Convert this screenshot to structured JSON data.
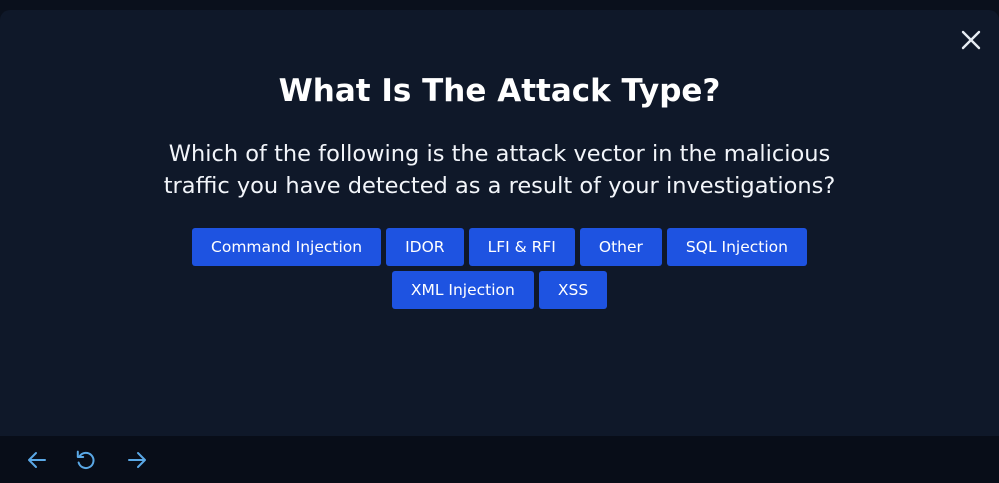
{
  "modal": {
    "title": "What Is The Attack Type?",
    "question": "Which of the following is the attack vector in the malicious traffic you have detected as a result of your investigations?",
    "options": [
      "Command Injection",
      "IDOR",
      "LFI & RFI",
      "Other",
      "SQL Injection",
      "XML Injection",
      "XSS"
    ]
  },
  "icons": {
    "close": "close-icon",
    "back": "arrow-left-icon",
    "reset": "rotate-ccw-icon",
    "forward": "arrow-right-icon"
  },
  "colors": {
    "background": "#0f1829",
    "button": "#1e53e1",
    "nav_icon": "#5aa8e6",
    "navbar": "#080d18"
  }
}
